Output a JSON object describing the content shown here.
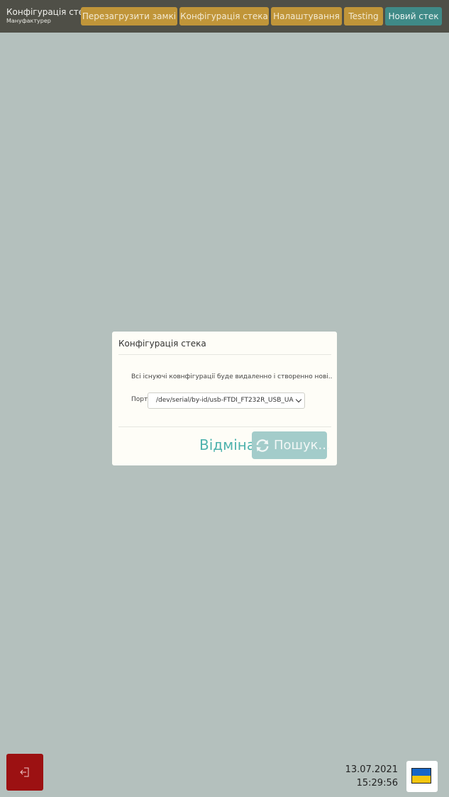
{
  "header": {
    "title": "Конфігурація стека",
    "subtitle": "Мануфактурер",
    "nav": [
      {
        "label": "Перезагрузити замкі"
      },
      {
        "label": "Конфігурація стека"
      },
      {
        "label": "Налаштування"
      },
      {
        "label": "Testing"
      },
      {
        "label": "Новий стек"
      }
    ]
  },
  "modal": {
    "title": "Конфігурація стека",
    "message": "Всі існуючі ковнфігурації буде видаленно і створенно нові..",
    "port_label": "Порт",
    "port_value": "/dev/serial/by-id/usb-FTDI_FT232R_USB_UA",
    "cancel_label": "Відміна",
    "search_label": "Пошук..."
  },
  "footer": {
    "date": "13.07.2021",
    "time": "15:29:56",
    "logout_icon": "logout-icon",
    "language_flag": "ukraine-flag"
  },
  "colors": {
    "background": "#b4c0bd",
    "header": "#4f4f47",
    "nav_button": "#c09539",
    "nav_button_primary": "#3f8a87",
    "accent_teal": "#4db2ad",
    "logout": "#9c1112"
  }
}
